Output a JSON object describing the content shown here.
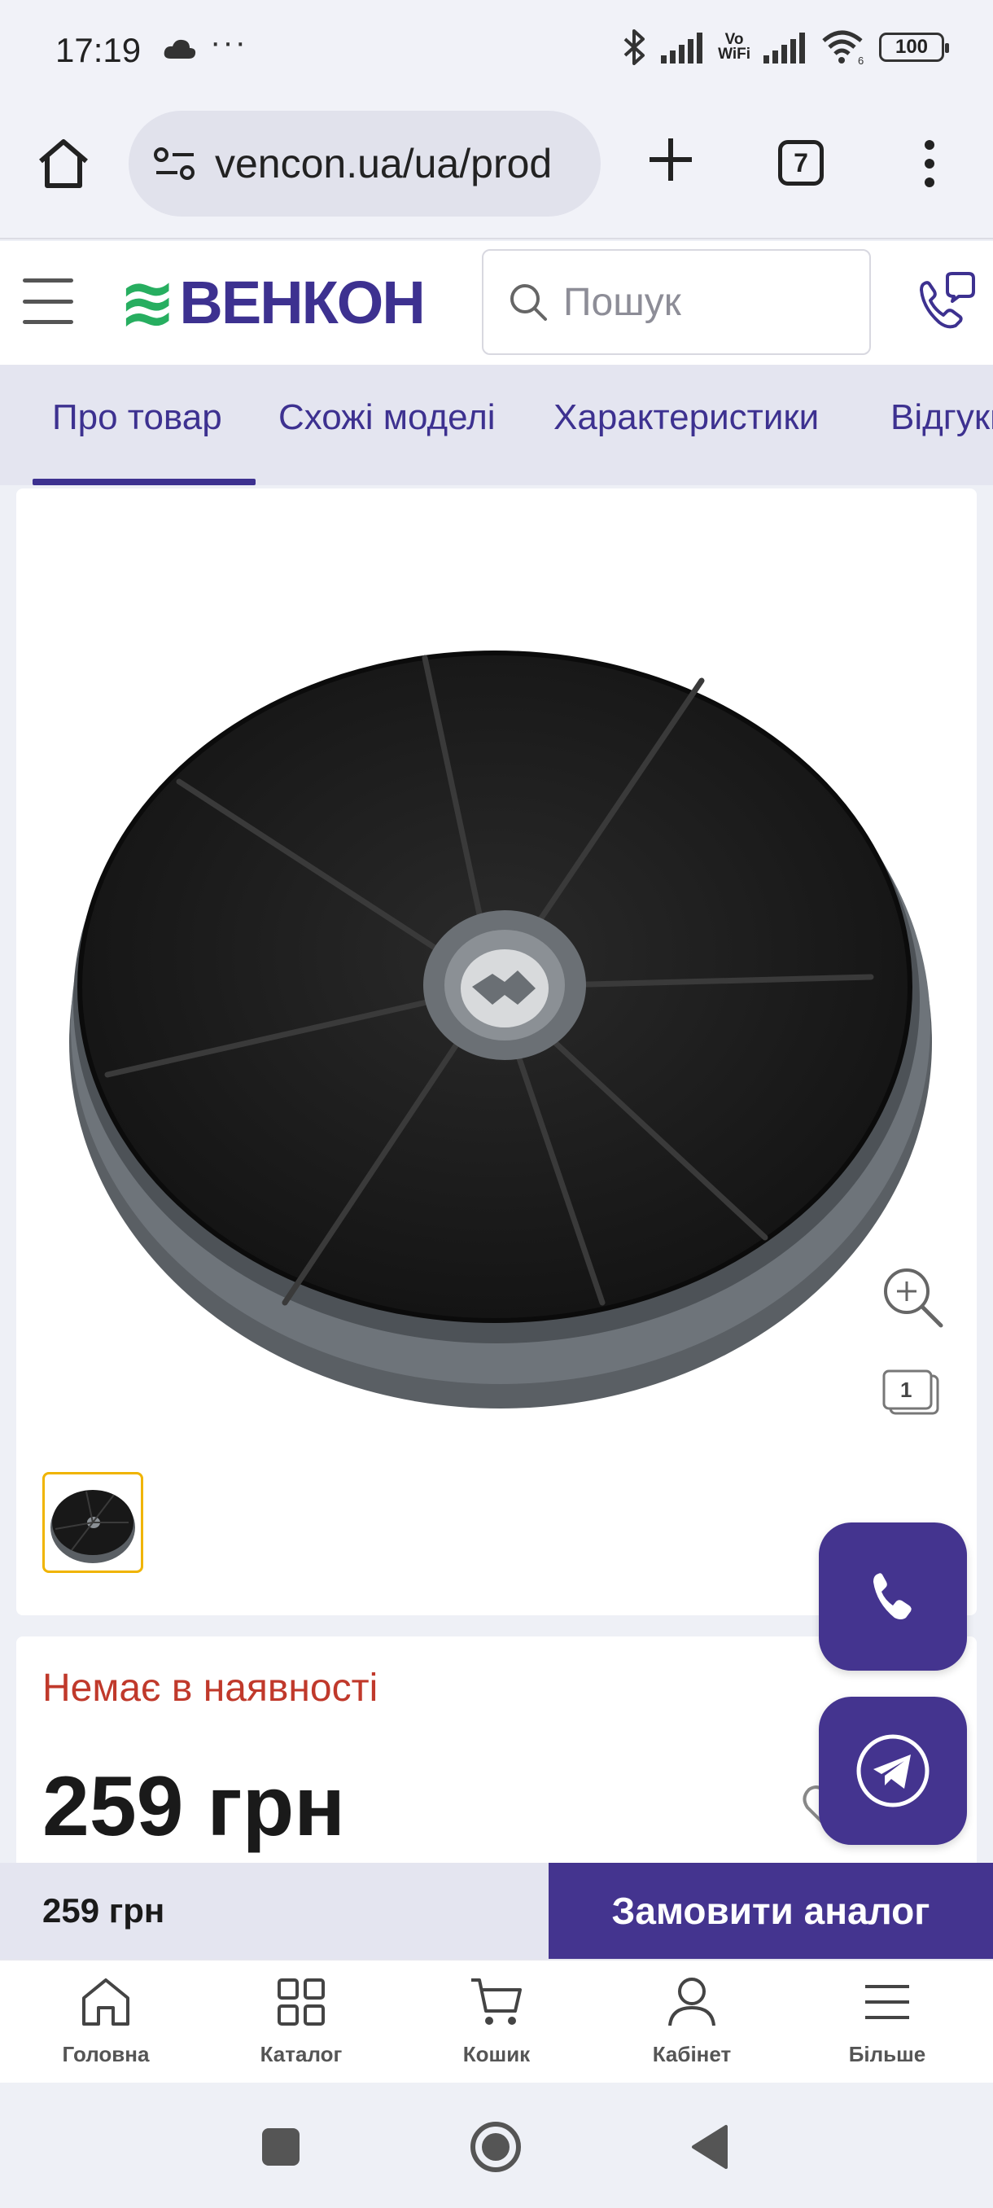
{
  "status_bar": {
    "time": "17:19",
    "dots": "···",
    "vo": "Vo",
    "wifi": "WiFi",
    "battery": "100",
    "wifi_sub": "6"
  },
  "browser": {
    "url": "vencon.ua/ua/prod",
    "tab_count": "7"
  },
  "site": {
    "logo_text": "ВЕНКОН",
    "logo_mark": "≋",
    "search_placeholder": "Пошук"
  },
  "tabs": [
    {
      "label": "Про товар",
      "active": true
    },
    {
      "label": "Схожі моделі",
      "active": false
    },
    {
      "label": "Характеристики",
      "active": false
    },
    {
      "label": "Відгуки",
      "active": false
    }
  ],
  "gallery": {
    "image_count": "1"
  },
  "product": {
    "availability": "Немає в наявності",
    "price": "259 грн"
  },
  "sticky_bar": {
    "price": "259 грн",
    "order_label": "Замовити аналог"
  },
  "bottom_nav": [
    {
      "label": "Головна",
      "icon": "home-icon"
    },
    {
      "label": "Каталог",
      "icon": "grid-icon"
    },
    {
      "label": "Кошик",
      "icon": "cart-icon"
    },
    {
      "label": "Кабінет",
      "icon": "user-icon"
    },
    {
      "label": "Більше",
      "icon": "menu-icon"
    }
  ],
  "colors": {
    "brand": "#3d3190",
    "accent_green": "#27ae60",
    "out_of_stock": "#c0392b",
    "thumb_border": "#f0b400"
  }
}
